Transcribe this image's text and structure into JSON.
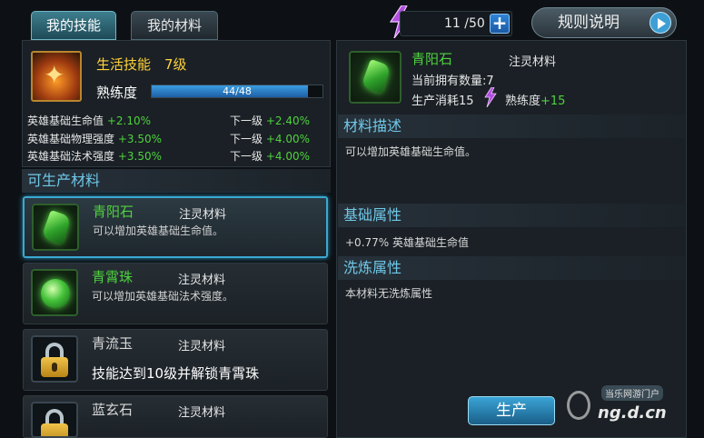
{
  "tabs": [
    {
      "label": "我的技能",
      "active": true
    },
    {
      "label": "我的材料",
      "active": false
    }
  ],
  "energy": {
    "icon": "lightning-icon",
    "glyph_label": "精",
    "count": "11 /50",
    "plus": "+"
  },
  "rules_button": "规则说明",
  "skill": {
    "title": "生活技能",
    "level": "7级",
    "proficiency_label": "熟练度",
    "progress_text": "44/48",
    "progress_fraction": 0.9167,
    "stats": [
      {
        "name": "英雄基础生命值",
        "value": "+2.10%",
        "next_label": "下一级",
        "next_value": "+2.40%"
      },
      {
        "name": "英雄基础物理强度",
        "value": "+3.50%",
        "next_label": "下一级",
        "next_value": "+4.00%"
      },
      {
        "name": "英雄基础法术强度",
        "value": "+3.50%",
        "next_label": "下一级",
        "next_value": "+4.00%"
      }
    ]
  },
  "producible_header": "可生产材料",
  "materials": [
    {
      "name": "青阳石",
      "kind": "注灵材料",
      "desc": "可以增加英雄基础生命值。",
      "icon": "green-crystal-icon",
      "locked": false,
      "selected": true
    },
    {
      "name": "青霄珠",
      "kind": "注灵材料",
      "desc": "可以增加英雄基础法术强度。",
      "icon": "green-orb-icon",
      "locked": false,
      "selected": false
    },
    {
      "name": "青流玉",
      "kind": "注灵材料",
      "desc": "技能达到10级并解锁青霄珠",
      "icon": "lock-icon",
      "locked": true,
      "selected": false
    },
    {
      "name": "蓝玄石",
      "kind": "注灵材料",
      "desc": "",
      "icon": "lock-icon",
      "locked": true,
      "selected": false
    }
  ],
  "detail": {
    "name": "青阳石",
    "kind": "注灵材料",
    "owned_label": "当前拥有数量:",
    "owned_value": "7",
    "cost_label": "生产消耗",
    "cost_value": "15",
    "prof_label": "熟练度",
    "prof_value": "+15",
    "desc_header": "材料描述",
    "desc_text": "可以增加英雄基础生命值。",
    "base_header": "基础属性",
    "base_text": "+0.77% 英雄基础生命值",
    "refine_header": "洗炼属性",
    "refine_text": "本材料无洗炼属性"
  },
  "produce_button": "生产",
  "watermark": {
    "top": "当乐网游门户",
    "brand": "ng.d.cn"
  },
  "colors": {
    "accent": "#6fc8e8",
    "positive": "#4fd23f",
    "gold": "#ffd23a"
  }
}
